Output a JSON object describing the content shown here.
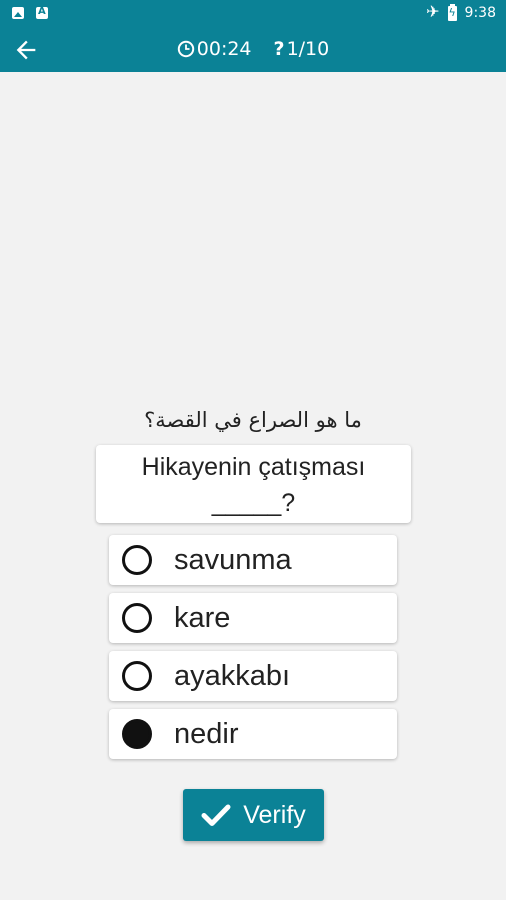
{
  "status_bar": {
    "left_icons": [
      "image-notification-icon",
      "app-notification-icon"
    ],
    "right_icons": [
      "airplane-mode-icon",
      "battery-charging-icon"
    ],
    "time": "9:38"
  },
  "app_bar": {
    "back_icon": "back-arrow-icon",
    "timer_icon": "clock-icon",
    "timer": "00:24",
    "progress_icon": "question-mark-icon",
    "progress": "1/10"
  },
  "question": {
    "translation": "ما هو الصراع في القصة؟",
    "sentence_line1": "Hikayenin çatışması",
    "sentence_line2": "_____?"
  },
  "options": [
    {
      "label": "savunma",
      "selected": false
    },
    {
      "label": "kare",
      "selected": false
    },
    {
      "label": "ayakkabı",
      "selected": false
    },
    {
      "label": "nedir",
      "selected": true
    }
  ],
  "verify_button": {
    "label": "Verify",
    "icon": "checkmark-icon"
  },
  "colors": {
    "primary": "#0b8296",
    "background": "#f2f2f2",
    "card": "#ffffff"
  }
}
